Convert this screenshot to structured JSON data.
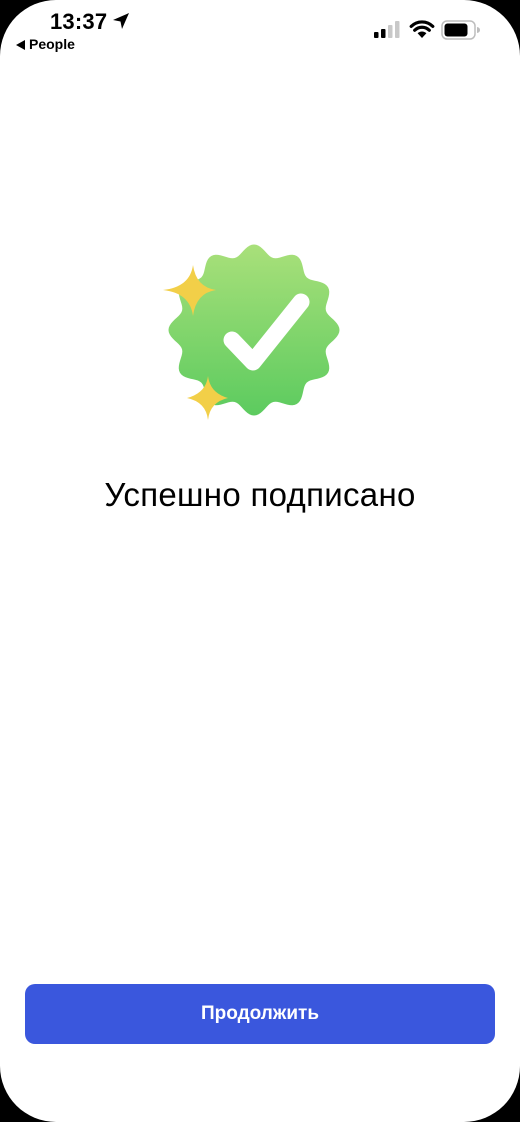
{
  "status_bar": {
    "time": "13:37",
    "back_label": "People",
    "icons": [
      "location-arrow-icon",
      "back-arrow-icon",
      "cellular-signal-icon",
      "wifi-icon",
      "battery-icon"
    ]
  },
  "main": {
    "badge_icon": "verified-checkmark-badge-icon",
    "title": "Успешно подписано"
  },
  "footer": {
    "continue_label": "Продолжить"
  },
  "colors": {
    "button": "#3a57dd",
    "badge_top": "#a9e07a",
    "badge_bottom": "#5ccb5f",
    "sparkle": "#f2cf48"
  }
}
